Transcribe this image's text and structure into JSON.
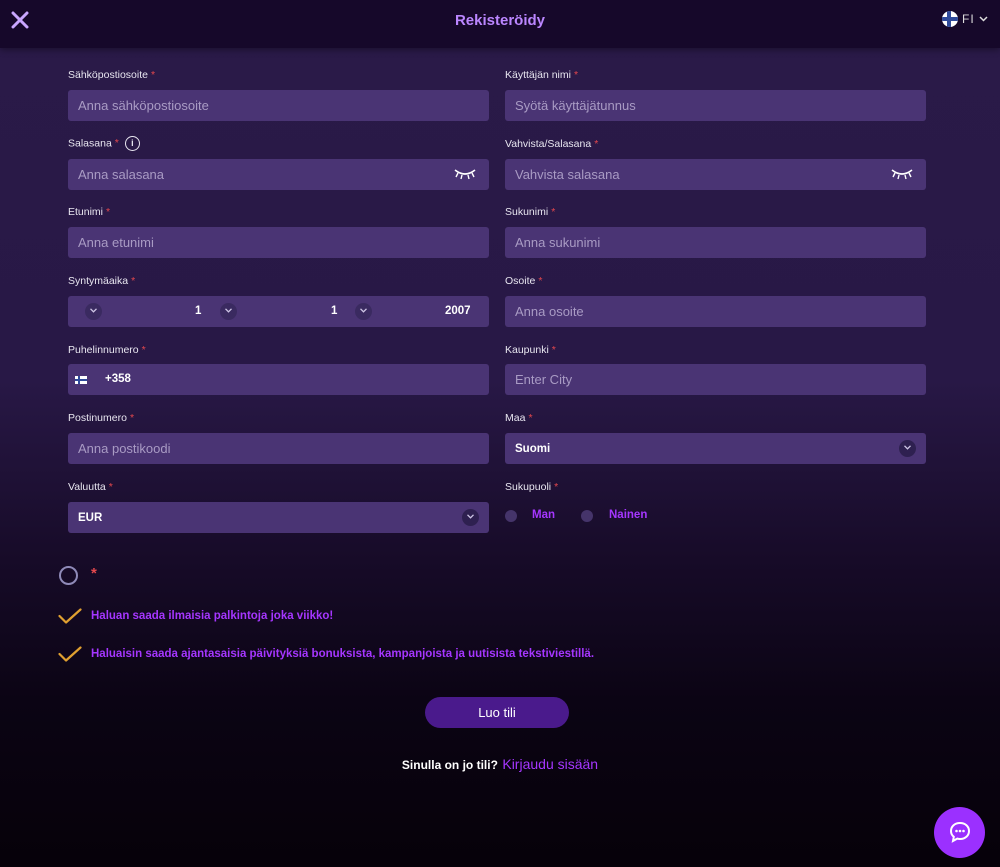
{
  "header": {
    "title": "Rekisteröidy",
    "language": "FI"
  },
  "form": {
    "email": {
      "label": "Sähköpostiosoite",
      "placeholder": "Anna sähköpostiosoite"
    },
    "username": {
      "label": "Käyttäjän nimi",
      "placeholder": "Syötä käyttäjätunnus"
    },
    "password": {
      "label": "Salasana",
      "placeholder": "Anna salasana"
    },
    "confirm_password": {
      "label": "Vahvista/Salasana",
      "placeholder": "Vahvista salasana"
    },
    "first_name": {
      "label": "Etunimi",
      "placeholder": "Anna etunimi"
    },
    "last_name": {
      "label": "Sukunimi",
      "placeholder": "Anna sukunimi"
    },
    "birthdate": {
      "label": "Syntymäaika",
      "day": "1",
      "month": "1",
      "year": "2007"
    },
    "address": {
      "label": "Osoite",
      "placeholder": "Anna osoite"
    },
    "phone": {
      "label": "Puhelinnumero",
      "prefix": "+358"
    },
    "city": {
      "label": "Kaupunki",
      "placeholder": "Enter City"
    },
    "postal_code": {
      "label": "Postinumero",
      "placeholder": "Anna postikoodi"
    },
    "country": {
      "label": "Maa",
      "value": "Suomi"
    },
    "currency": {
      "label": "Valuutta",
      "value": "EUR"
    },
    "gender": {
      "label": "Sukupuoli",
      "options": [
        "Man",
        "Nainen"
      ]
    },
    "required_mark": "*",
    "info_glyph": "i"
  },
  "consents": {
    "terms_mark": "*",
    "weekly_rewards": "Haluan saada ilmaisia palkintoja joka viikko!",
    "sms_updates": "Haluaisin saada ajantasaisia päivityksiä bonuksista, kampanjoista ja uutisista tekstiviestillä."
  },
  "actions": {
    "submit": "Luo tili",
    "have_account": "Sinulla on jo tili?",
    "login_link": "Kirjaudu sisään"
  },
  "icons": {
    "close": "close-icon",
    "flag": "finland-flag-icon",
    "eye": "eye-closed-icon",
    "chevron": "chevron-down-icon",
    "check": "check-icon",
    "chat": "chat-bubble-icon"
  },
  "colors": {
    "accent": "#a536ff",
    "title": "#bb86ff",
    "field_bg": "#4a3474",
    "check": "#e0a030",
    "required": "#e5484d",
    "button_bg": "#4a1a8c"
  }
}
